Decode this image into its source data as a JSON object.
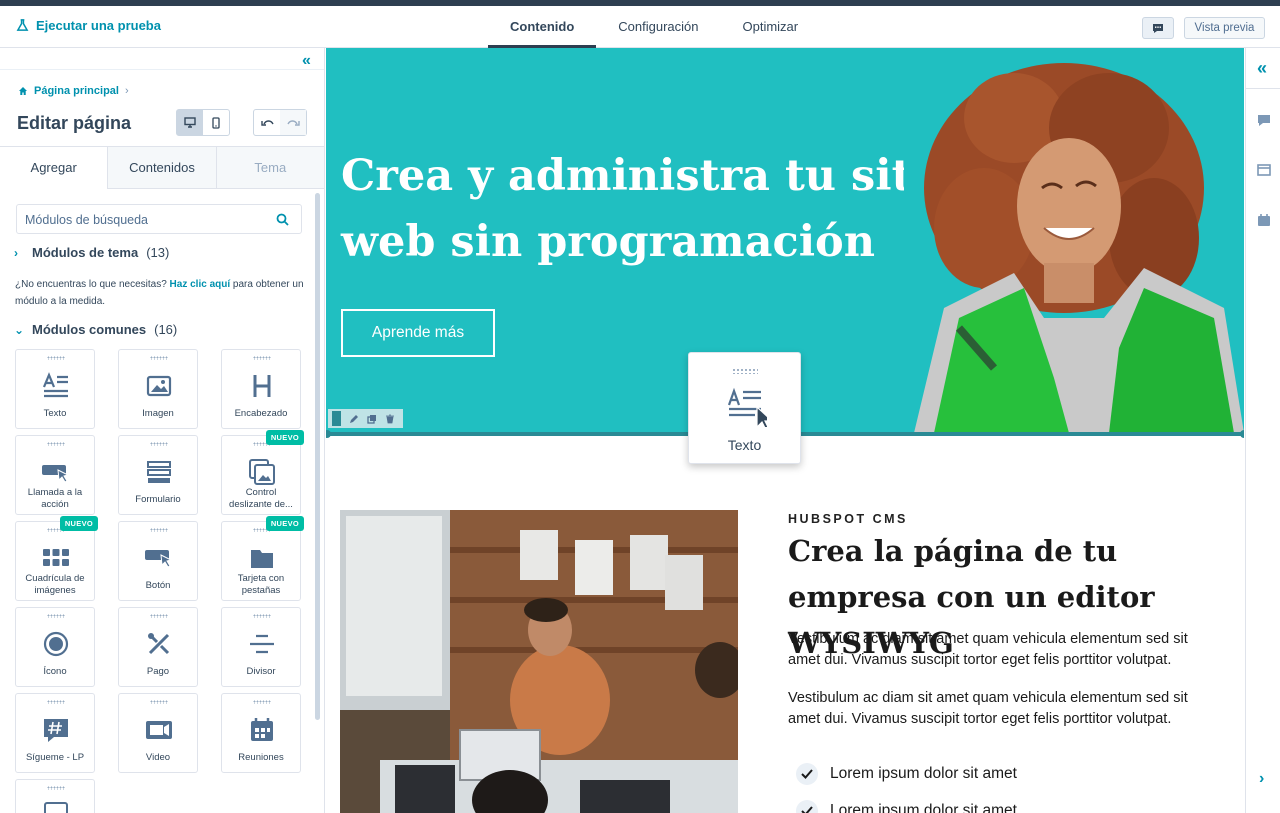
{
  "topbar": {
    "run_test": "Ejecutar una prueba",
    "tabs": [
      {
        "label": "Contenido",
        "active": true
      },
      {
        "label": "Configuración",
        "active": false
      },
      {
        "label": "Optimizar",
        "active": false
      }
    ],
    "preview_label": "Vista previa"
  },
  "sidebar": {
    "breadcrumb": "Página principal",
    "title": "Editar página",
    "tabs": [
      "Agregar",
      "Contenidos",
      "Tema"
    ],
    "search_placeholder": "Módulos de búsqueda",
    "theme_modules": {
      "label": "Módulos de tema",
      "count": "(13)"
    },
    "hint": {
      "before": "¿No encuentras lo que necesitas? ",
      "link": "Haz clic aquí",
      "after": " para obtener un módulo a la medida."
    },
    "common_modules": {
      "label": "Módulos comunes",
      "count": "(16)"
    },
    "modules": [
      {
        "label": "Texto",
        "icon": "text-icon"
      },
      {
        "label": "Imagen",
        "icon": "image-icon"
      },
      {
        "label": "Encabezado",
        "icon": "heading-icon"
      },
      {
        "label": "Llamada a la acción",
        "icon": "cta-icon"
      },
      {
        "label": "Formulario",
        "icon": "form-icon"
      },
      {
        "label": "Control deslizante de...",
        "icon": "slider-icon",
        "badge": "NUEVO"
      },
      {
        "label": "Cuadrícula de imágenes",
        "icon": "image-grid-icon",
        "badge": "NUEVO"
      },
      {
        "label": "Botón",
        "icon": "button-icon"
      },
      {
        "label": "Tarjeta con pestañas",
        "icon": "folder-icon",
        "badge": "NUEVO"
      },
      {
        "label": "Ícono",
        "icon": "icon-icon"
      },
      {
        "label": "Pago",
        "icon": "tools-icon"
      },
      {
        "label": "Divisor",
        "icon": "divider-icon"
      },
      {
        "label": "Sígueme - LP",
        "icon": "hashtag-icon"
      },
      {
        "label": "Video",
        "icon": "video-icon"
      },
      {
        "label": "Reuniones",
        "icon": "calendar-icon"
      }
    ]
  },
  "canvas": {
    "hero_title": "Crea y administra tu sitio web sin programación",
    "hero_button": "Aprende más",
    "drag_label": "Texto",
    "kicker": "HUBSPOT CMS",
    "heading": "Crea la página de tu empresa con un editor WYSIWYG",
    "para1": "Vestibulum ac diam sit amet quam vehicula elementum sed sit amet dui. Vivamus suscipit tortor eget felis porttitor volutpat.",
    "para2": "Vestibulum ac diam sit amet quam vehicula elementum sed sit amet dui. Vivamus suscipit tortor eget felis porttitor volutpat.",
    "checks": [
      "Lorem ipsum dolor sit amet",
      "Lorem ipsum dolor sit amet"
    ]
  },
  "colors": {
    "accent": "#0091ae",
    "hero": "#20bfc1",
    "badge": "#00bda5",
    "selection": "#2a8a95"
  }
}
